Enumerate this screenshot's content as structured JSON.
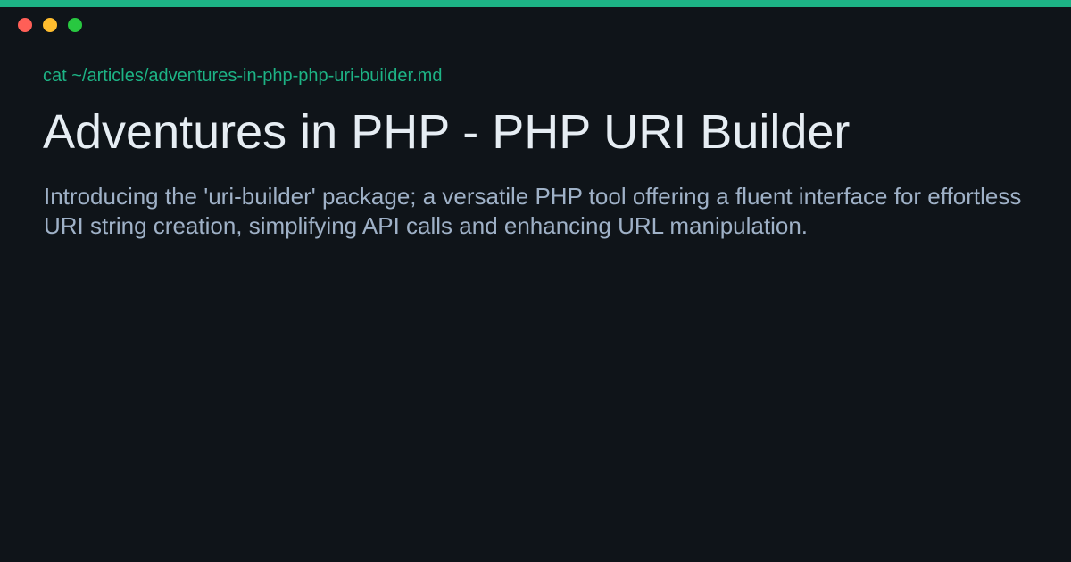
{
  "colors": {
    "background": "#0f1419",
    "accent": "#1db385",
    "close": "#ff5f57",
    "minimize": "#febc2e",
    "maximize": "#28c840",
    "command": "#1db385",
    "title": "#e6edf3",
    "description": "#9fb1c7"
  },
  "window": {
    "controls": [
      "close-dot",
      "minimize-dot",
      "maximize-dot"
    ]
  },
  "terminal": {
    "command": "cat ~/articles/adventures-in-php-php-uri-builder.md"
  },
  "article": {
    "title": "Adventures in PHP - PHP URI Builder",
    "description": "Introducing the 'uri-builder' package; a versatile PHP tool offering a fluent interface for effortless URI string creation, simplifying API calls and enhancing URL manipulation."
  }
}
